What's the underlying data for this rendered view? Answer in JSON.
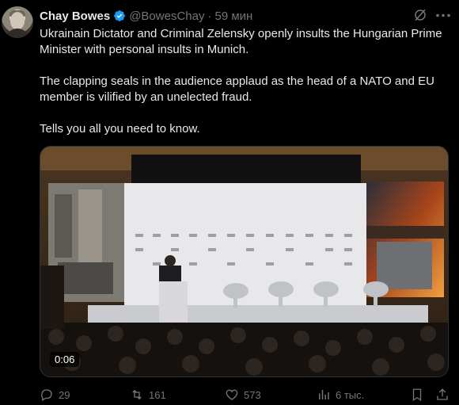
{
  "author": {
    "name": "Chay Bowes",
    "handle": "@BowesChay",
    "separator": "·",
    "time": "59 мин"
  },
  "tweet": {
    "paragraphs": [
      "Ukrainain Dictator and Criminal Zelensky openly insults the Hungarian Prime Minister with personal insults in Munich.",
      "The clapping seals in the audience applaud as the head of a NATO and EU member is vilified by an unelected fraud.",
      "Tells you all you need to know."
    ]
  },
  "media": {
    "timer": "0:06"
  },
  "actions": {
    "replies": "29",
    "reposts": "161",
    "likes": "573",
    "views": "6 тыс."
  },
  "colors": {
    "background": "#000000",
    "text": "#e7e9ea",
    "muted": "#71767b",
    "verified": "#1d9bf0"
  },
  "icons": [
    "avatar",
    "verified-icon",
    "grok-icon",
    "more-icon",
    "reply-icon",
    "repost-icon",
    "like-icon",
    "views-icon",
    "bookmark-icon",
    "share-icon"
  ]
}
